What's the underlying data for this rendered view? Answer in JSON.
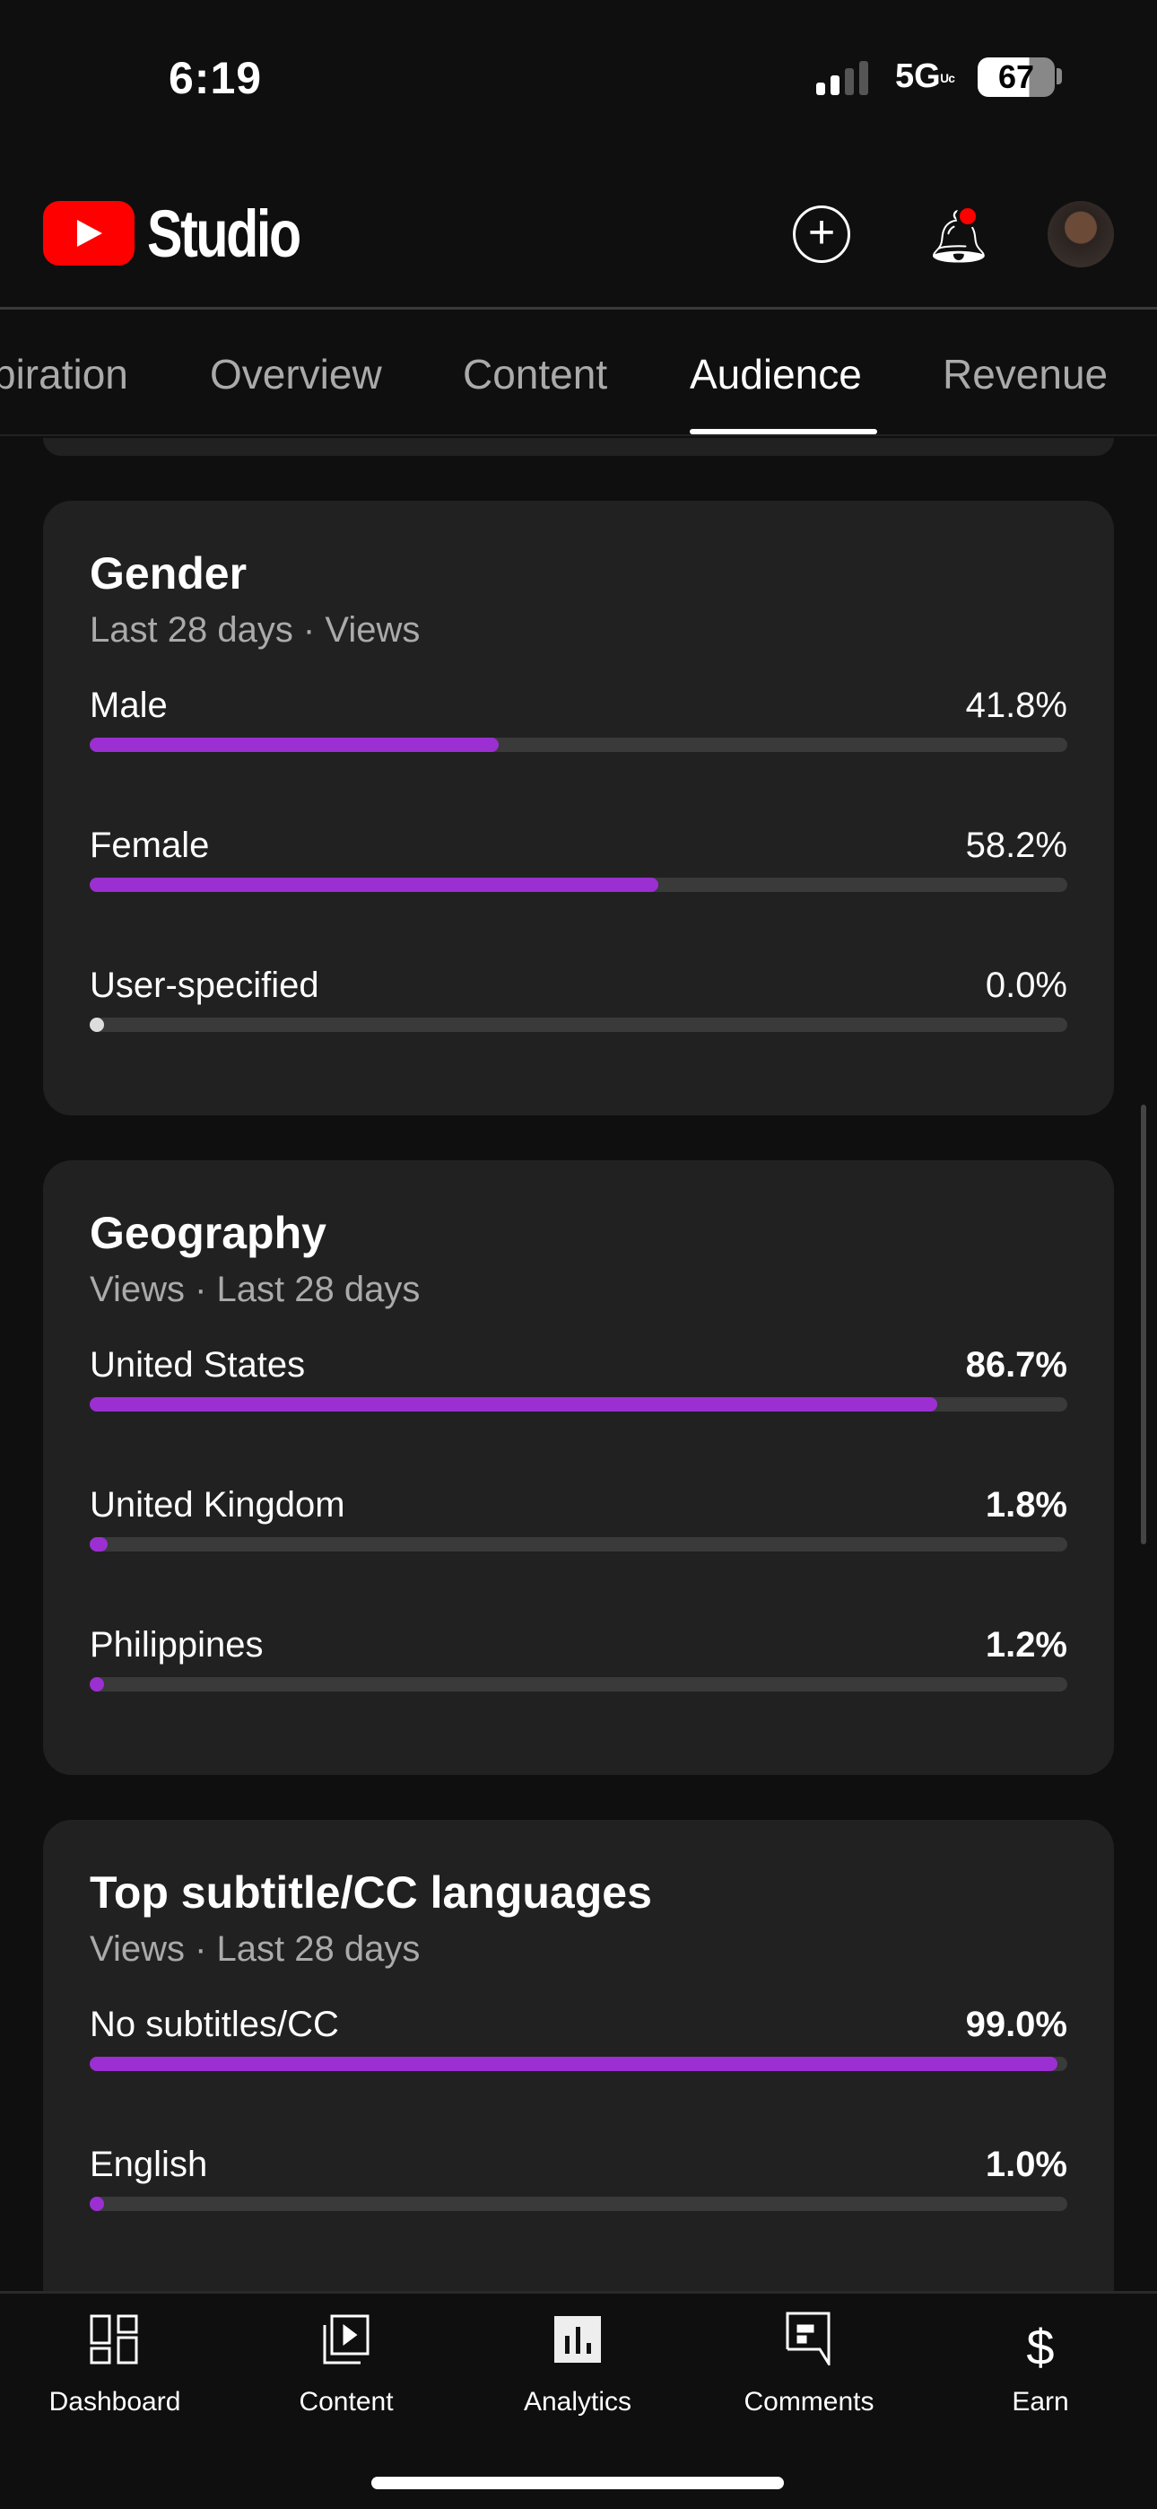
{
  "status_bar": {
    "time": "6:19",
    "network": "5G UC",
    "battery": "67"
  },
  "header": {
    "app_name": "Studio",
    "icons": [
      "create-icon",
      "bell-icon",
      "avatar"
    ]
  },
  "tabs": [
    {
      "label": "Inspiration",
      "visible": "piration"
    },
    {
      "label": "Overview"
    },
    {
      "label": "Content"
    },
    {
      "label": "Audience",
      "active": true
    },
    {
      "label": "Revenue"
    }
  ],
  "colors": {
    "bar_fill": "#9b2fd2",
    "track": "#3a3a3a",
    "card": "#212121",
    "background": "#0f0f0f"
  },
  "cards": [
    {
      "title": "Gender",
      "subtitle": "Last 28 days · Views",
      "rows": [
        {
          "label": "Male",
          "value": "41.8%",
          "pct": 41.8
        },
        {
          "label": "Female",
          "value": "58.2%",
          "pct": 58.2
        },
        {
          "label": "User-specified",
          "value": "0.0%",
          "pct": 0
        }
      ]
    },
    {
      "title": "Geography",
      "subtitle": "Views · Last 28 days",
      "rows": [
        {
          "label": "United States",
          "value": "86.7%",
          "pct": 86.7
        },
        {
          "label": "United Kingdom",
          "value": "1.8%",
          "pct": 1.8
        },
        {
          "label": "Philippines",
          "value": "1.2%",
          "pct": 1.2
        }
      ]
    },
    {
      "title": "Top subtitle/CC languages",
      "subtitle": "Views · Last 28 days",
      "rows": [
        {
          "label": "No subtitles/CC",
          "value": "99.0%",
          "pct": 99.0
        },
        {
          "label": "English",
          "value": "1.0%",
          "pct": 1.0
        }
      ]
    }
  ],
  "bottom_nav": [
    {
      "label": "Dashboard",
      "icon": "dashboard-icon"
    },
    {
      "label": "Content",
      "icon": "content-icon"
    },
    {
      "label": "Analytics",
      "icon": "analytics-icon",
      "active": true
    },
    {
      "label": "Comments",
      "icon": "comments-icon"
    },
    {
      "label": "Earn",
      "icon": "dollar-icon"
    }
  ]
}
